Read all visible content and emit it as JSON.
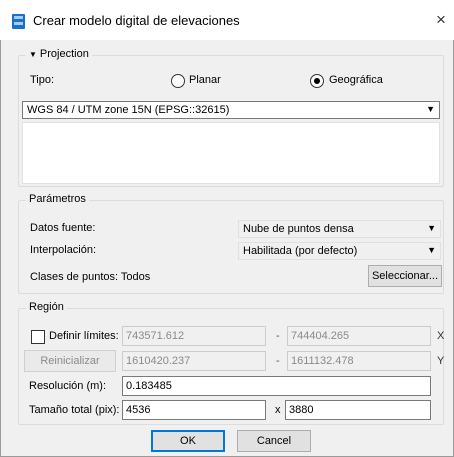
{
  "window": {
    "title": "Crear modelo digital de elevaciones",
    "close_icon": "×"
  },
  "projection": {
    "legend": "Projection",
    "tipo_label": "Tipo:",
    "option_planar": "Planar",
    "option_geografica": "Geográfica",
    "selected": "Geográfica",
    "crs_value": "WGS 84 / UTM zone 15N (EPSG::32615)"
  },
  "parametros": {
    "legend": "Parámetros",
    "datos_label": "Datos fuente:",
    "datos_value": "Nube de puntos densa",
    "interp_label": "Interpolación:",
    "interp_value": "Habilitada (por defecto)",
    "clases_label": "Clases de puntos:",
    "clases_value": "Todos",
    "seleccionar_button": "Seleccionar..."
  },
  "region": {
    "legend": "Región",
    "definir_label": "Definir límites:",
    "definir_checked": false,
    "reinicializar_button": "Reinicializar",
    "x_min": "743571.612",
    "x_max": "744404.265",
    "x_axis": "X",
    "y_min": "1610420.237",
    "y_max": "1611132.478",
    "y_axis": "Y",
    "dash": "-",
    "resolucion_label": "Resolución (m):",
    "resolucion_value": "0.183485",
    "tamano_label": "Tamaño total (pix):",
    "tamano_w": "4536",
    "tamano_sep": "x",
    "tamano_h": "3880"
  },
  "buttons": {
    "ok": "OK",
    "cancel": "Cancel"
  },
  "colors": {
    "accent": "#0078d7",
    "dialog_bg": "#f0f0f0",
    "icon_blue": "#1e6fc8"
  }
}
